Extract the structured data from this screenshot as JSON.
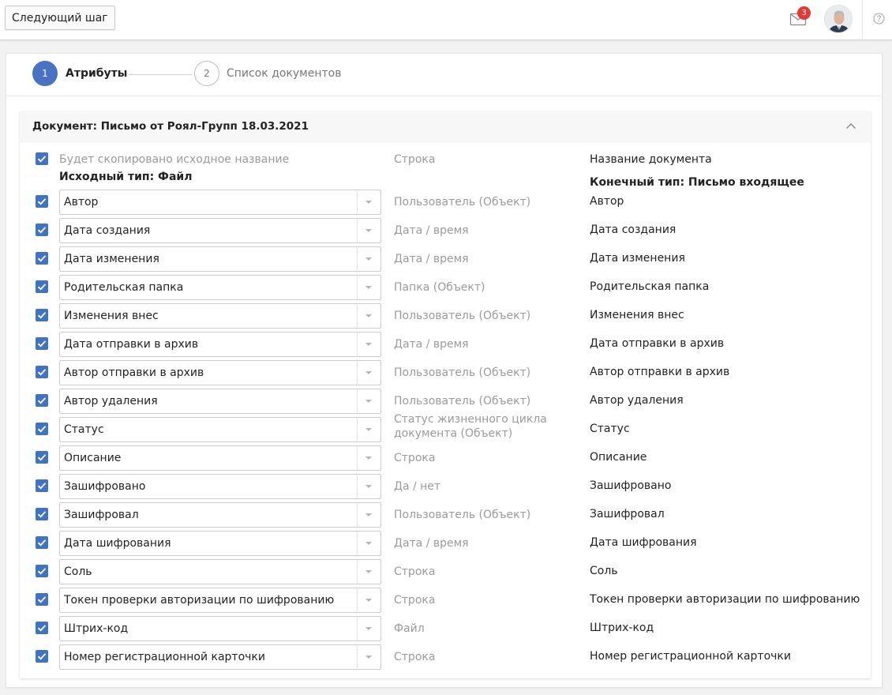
{
  "toolbar": {
    "next_step_label": "Следующий шаг"
  },
  "header": {
    "mail_badge_count": "3"
  },
  "stepper": {
    "steps": [
      {
        "number": "1",
        "label": "Атрибуты"
      },
      {
        "number": "2",
        "label": "Список документов"
      }
    ]
  },
  "document": {
    "title": "Документ: Письмо от Роял-Групп 18.03.2021",
    "header_row": {
      "source_note": "Будет скопировано исходное название",
      "source_type": "Исходный тип: Файл",
      "type": "Строка",
      "destination": "Название документа",
      "destination_type": "Конечный тип: Письмо входящее"
    },
    "rows": [
      {
        "source": "Автор",
        "type": "Пользователь (Объект)",
        "destination": "Автор"
      },
      {
        "source": "Дата создания",
        "type": "Дата / время",
        "destination": "Дата создания"
      },
      {
        "source": "Дата изменения",
        "type": "Дата / время",
        "destination": "Дата изменения"
      },
      {
        "source": "Родительская папка",
        "type": "Папка (Объект)",
        "destination": "Родительская папка"
      },
      {
        "source": "Изменения внес",
        "type": "Пользователь (Объект)",
        "destination": "Изменения внес"
      },
      {
        "source": "Дата отправки в архив",
        "type": "Дата / время",
        "destination": "Дата отправки в архив"
      },
      {
        "source": "Автор отправки в архив",
        "type": "Пользователь (Объект)",
        "destination": "Автор отправки в архив"
      },
      {
        "source": "Автор удаления",
        "type": "Пользователь (Объект)",
        "destination": "Автор удаления"
      },
      {
        "source": "Статус",
        "type": "Статус жизненного цикла",
        "type_line2": "документа (Объект)",
        "destination": "Статус"
      },
      {
        "source": "Описание",
        "type": "Строка",
        "destination": "Описание"
      },
      {
        "source": "Зашифровано",
        "type": "Да / нет",
        "destination": "Зашифровано"
      },
      {
        "source": "Зашифровал",
        "type": "Пользователь (Объект)",
        "destination": "Зашифровал"
      },
      {
        "source": "Дата шифрования",
        "type": "Дата / время",
        "destination": "Дата шифрования"
      },
      {
        "source": "Соль",
        "type": "Строка",
        "destination": "Соль"
      },
      {
        "source": "Токен проверки авторизации по шифрованию",
        "type": "Строка",
        "destination": "Токен проверки авторизации по шифрованию"
      },
      {
        "source": "Штрих-код",
        "type": "Файл",
        "destination": "Штрих-код"
      },
      {
        "source": "Номер регистрационной карточки",
        "type": "Строка",
        "destination": "Номер регистрационной карточки"
      }
    ]
  },
  "colors": {
    "accent": "#3f74c4",
    "badge": "#e53935"
  }
}
